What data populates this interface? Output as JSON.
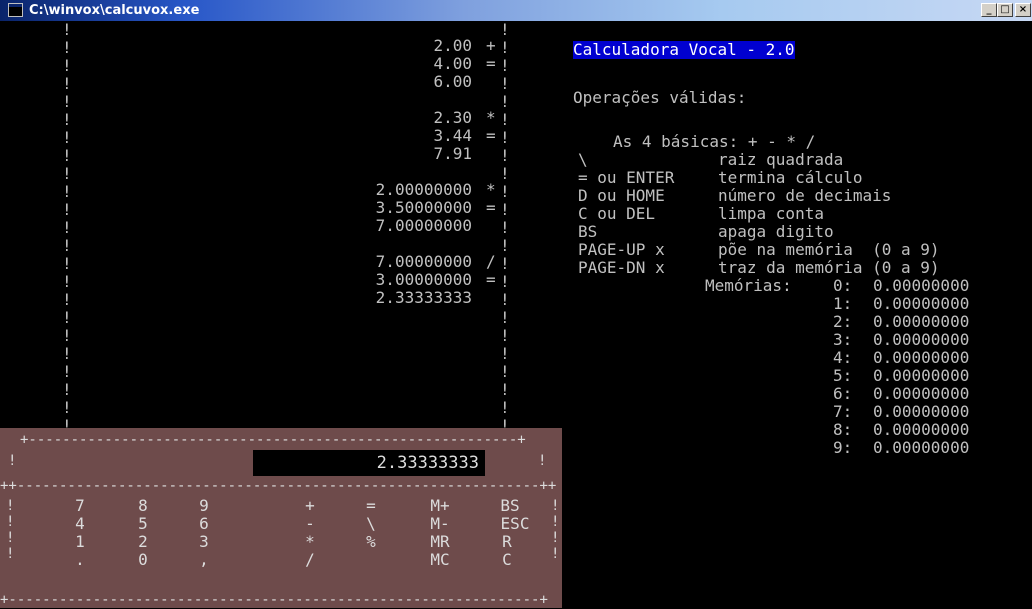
{
  "window": {
    "title": "C:\\winvox\\calcuvox.exe",
    "controls": {
      "minimize": "_",
      "maximize": "□",
      "close": "×"
    }
  },
  "tape": [
    {
      "value": "2.00",
      "op": "+"
    },
    {
      "value": "4.00",
      "op": "="
    },
    {
      "value": "6.00",
      "op": ""
    },
    {
      "value": "",
      "op": ""
    },
    {
      "value": "2.30",
      "op": "*"
    },
    {
      "value": "3.44",
      "op": "="
    },
    {
      "value": "7.91",
      "op": ""
    },
    {
      "value": "",
      "op": ""
    },
    {
      "value": "2.00000000",
      "op": "*"
    },
    {
      "value": "3.50000000",
      "op": "="
    },
    {
      "value": "7.00000000",
      "op": ""
    },
    {
      "value": "",
      "op": ""
    },
    {
      "value": "7.00000000",
      "op": "/"
    },
    {
      "value": "3.00000000",
      "op": "="
    },
    {
      "value": "2.33333333",
      "op": ""
    }
  ],
  "help": {
    "heading": "Calculadora Vocal - 2.0",
    "valid_ops": "Operações válidas:",
    "basics": "As 4 básicas: + - * /",
    "commands": [
      {
        "key": "\\",
        "desc": "raiz quadrada"
      },
      {
        "key": "= ou ENTER",
        "desc": "termina cálculo"
      },
      {
        "key": "D ou HOME",
        "desc": "número de decimais"
      },
      {
        "key": "C ou DEL",
        "desc": "limpa conta"
      },
      {
        "key": "BS",
        "desc": "apaga digito"
      },
      {
        "key": "PAGE-UP x",
        "desc": "põe na memória  (0 a 9)"
      },
      {
        "key": "PAGE-DN x",
        "desc": "traz da memória (0 a 9)"
      }
    ],
    "memories_label": "Memórias:",
    "memories": [
      {
        "index": "0:",
        "value": "0.00000000"
      },
      {
        "index": "1:",
        "value": "0.00000000"
      },
      {
        "index": "2:",
        "value": "0.00000000"
      },
      {
        "index": "3:",
        "value": "0.00000000"
      },
      {
        "index": "4:",
        "value": "0.00000000"
      },
      {
        "index": "5:",
        "value": "0.00000000"
      },
      {
        "index": "6:",
        "value": "0.00000000"
      },
      {
        "index": "7:",
        "value": "0.00000000"
      },
      {
        "index": "8:",
        "value": "0.00000000"
      },
      {
        "index": "9:",
        "value": "0.00000000"
      }
    ]
  },
  "keypad": {
    "display": "2.33333333",
    "rows": [
      [
        "7",
        "8",
        "9",
        "+",
        "=",
        "M+",
        "BS"
      ],
      [
        "4",
        "5",
        "6",
        "-",
        "\\",
        "M-",
        "ESC"
      ],
      [
        "1",
        "2",
        "3",
        "*",
        "%",
        "MR",
        "R"
      ],
      [
        ".",
        "0",
        ",",
        "/",
        "",
        "MC",
        "C"
      ]
    ]
  },
  "colors": {
    "console_bg": "#000000",
    "console_text": "#c0c0c0",
    "heading_bg": "#0000d0",
    "keypad_bg": "#6e4b4b"
  }
}
